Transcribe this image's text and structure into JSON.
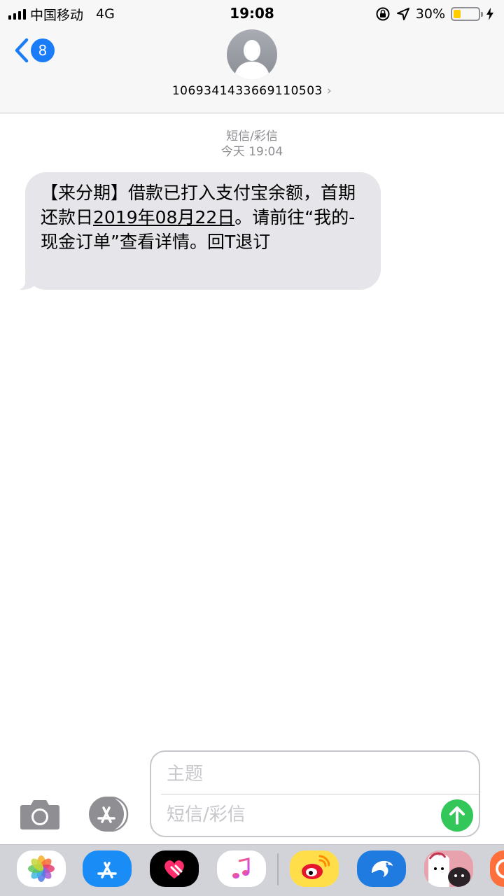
{
  "status_bar": {
    "carrier": "中国移动",
    "network": "4G",
    "time": "19:08",
    "battery_percent": "30%",
    "battery_level": 0.3
  },
  "header": {
    "back_badge": "8",
    "contact": "1069341433669110503"
  },
  "thread": {
    "service_label": "短信/彩信",
    "timestamp": "今天 19:04",
    "message": {
      "part1": "【来分期】借款已打入支付宝余额，首期还款日",
      "date": "2019年08月22日",
      "part2": "。请前往“我的-现金订单”查看详情。回T退订"
    }
  },
  "composer": {
    "subject_placeholder": "主题",
    "message_placeholder": "短信/彩信"
  },
  "app_drawer": {
    "apps": [
      "photos-icon",
      "app-store-icon",
      "digital-touch-icon",
      "music-icon",
      "weibo-icon",
      "dolphin-app-icon",
      "sticker-pack-icon",
      "partial-app-icon"
    ]
  },
  "colors": {
    "accent": "#1a7cf7",
    "send": "#33c75a",
    "bubble": "#e5e5ea",
    "battery": "#ffcc00"
  }
}
